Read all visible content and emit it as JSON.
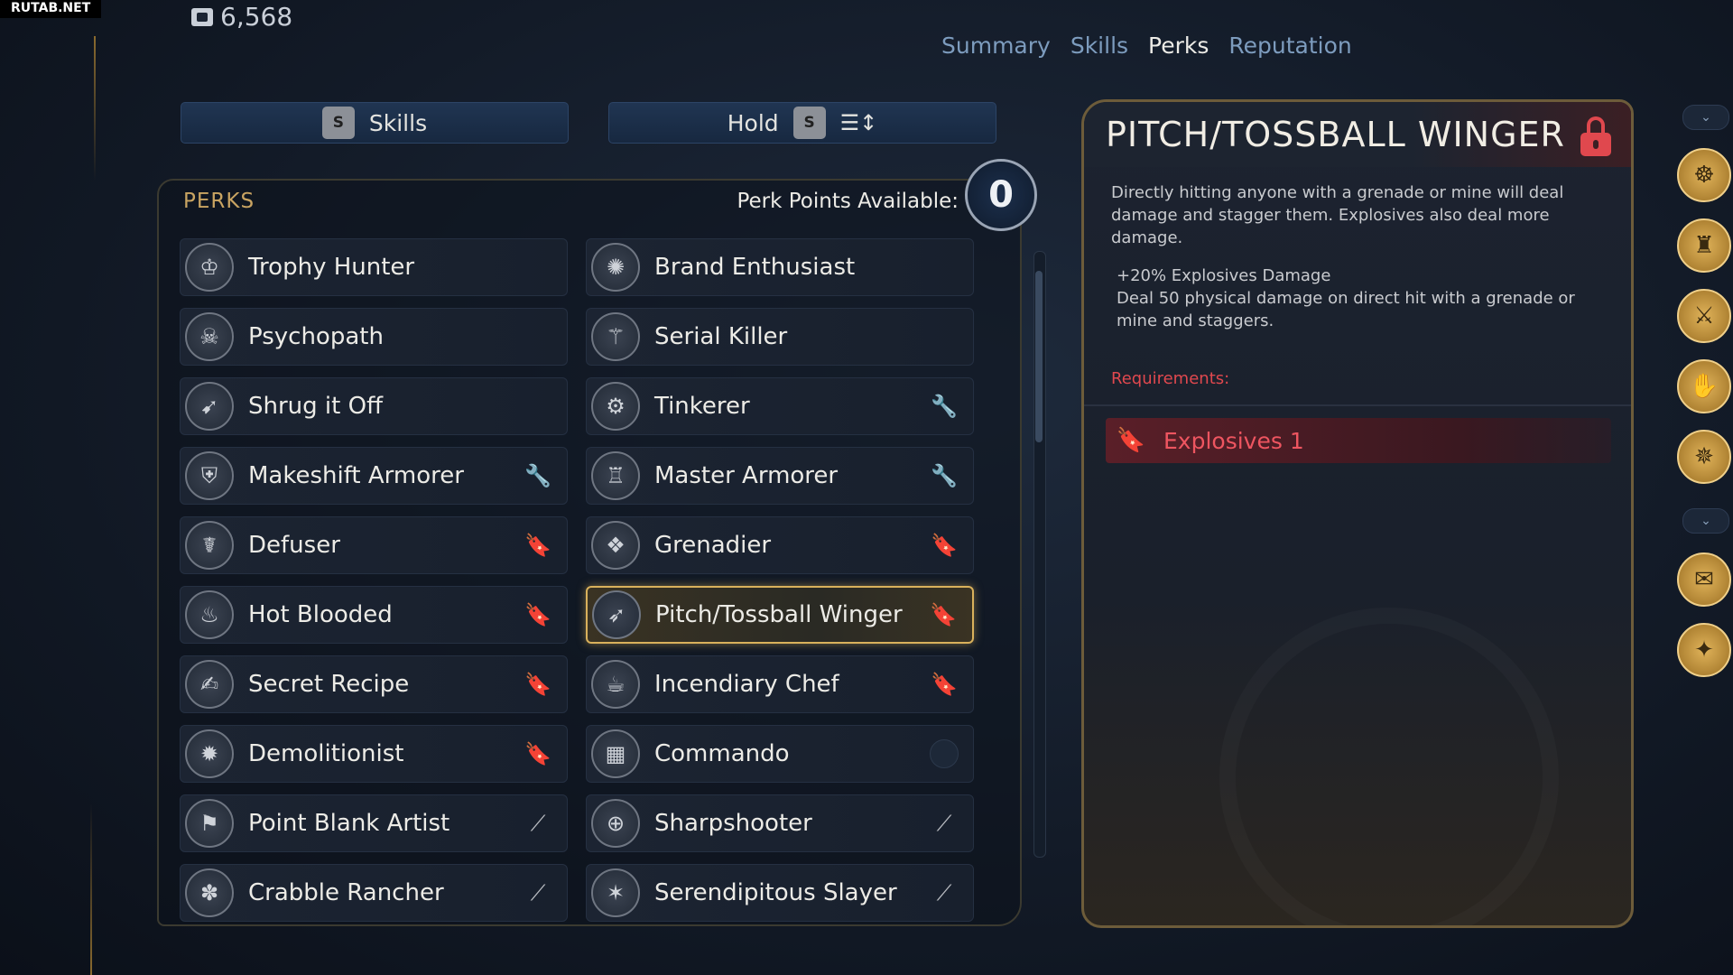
{
  "watermark": "RUTAB.NET",
  "currency": {
    "value": "6,568",
    "icon": "token-icon"
  },
  "tabs": [
    {
      "label": "Summary",
      "active": false
    },
    {
      "label": "Skills",
      "active": false
    },
    {
      "label": "Perks",
      "active": true
    },
    {
      "label": "Reputation",
      "active": false
    }
  ],
  "buttons": {
    "skills": {
      "key": "S",
      "label": "Skills"
    },
    "hold": {
      "label": "Hold",
      "key": "S",
      "icon": "sort-icon"
    }
  },
  "perks_panel": {
    "title": "PERKS",
    "points_label": "Perk Points Available:",
    "points_value": "0"
  },
  "perks": [
    {
      "name": "Trophy Hunter",
      "icon": "trophy-icon",
      "tag": ""
    },
    {
      "name": "Brand Enthusiast",
      "icon": "burst-icon",
      "tag": ""
    },
    {
      "name": "Psychopath",
      "icon": "skull-icon",
      "tag": ""
    },
    {
      "name": "Serial Killer",
      "icon": "blade-icon",
      "tag": ""
    },
    {
      "name": "Shrug it Off",
      "icon": "shrug-icon",
      "tag": ""
    },
    {
      "name": "Tinkerer",
      "icon": "gear-bot-icon",
      "tag": "wrench-icon"
    },
    {
      "name": "Makeshift Armorer",
      "icon": "armor-icon",
      "tag": "wrench-icon"
    },
    {
      "name": "Master Armorer",
      "icon": "armor-master-icon",
      "tag": "wrench-icon"
    },
    {
      "name": "Defuser",
      "icon": "defuser-icon",
      "tag": "grenade-icon"
    },
    {
      "name": "Grenadier",
      "icon": "grenades-icon",
      "tag": "grenade-icon"
    },
    {
      "name": "Hot Blooded",
      "icon": "flame-icon",
      "tag": "grenade-icon"
    },
    {
      "name": "Pitch/Tossball Winger",
      "icon": "throw-icon",
      "tag": "grenade-icon",
      "selected": true
    },
    {
      "name": "Secret Recipe",
      "icon": "recipe-icon",
      "tag": "grenade-icon"
    },
    {
      "name": "Incendiary Chef",
      "icon": "chef-icon",
      "tag": "grenade-icon"
    },
    {
      "name": "Demolitionist",
      "icon": "explosion-icon",
      "tag": "grenade-icon"
    },
    {
      "name": "Commando",
      "icon": "grid-icon",
      "tag": "empty-slot"
    },
    {
      "name": "Point Blank Artist",
      "icon": "pistol-icon",
      "tag": "gun-icon"
    },
    {
      "name": "Sharpshooter",
      "icon": "crosshair-icon",
      "tag": "gun-icon"
    },
    {
      "name": "Crabble Rancher",
      "icon": "crab-icon",
      "tag": "gun-icon"
    },
    {
      "name": "Serendipitous Slayer",
      "icon": "star-burst-icon",
      "tag": "gun-icon"
    }
  ],
  "detail": {
    "title": "PITCH/TOSSBALL WINGER",
    "locked": true,
    "description": "Directly hitting anyone with a grenade or mine will deal damage and stagger them. Explosives also deal more damage.",
    "bonus_1": "+20% Explosives Damage",
    "bonus_2": "Deal 50 physical damage on direct hit with a grenade or mine and staggers.",
    "requirements_label": "Requirements:",
    "requirement": {
      "label": "Explosives 1",
      "icon": "grenade-icon"
    }
  },
  "sidebar": [
    {
      "icon": "character-icon"
    },
    {
      "icon": "companion-icon"
    },
    {
      "icon": "melee-icon"
    },
    {
      "icon": "hand-icon"
    },
    {
      "icon": "stealth-icon"
    },
    {
      "icon": "map-icon"
    },
    {
      "icon": "creature-icon"
    }
  ],
  "colors": {
    "accent_gold": "#d9b15c",
    "locked_red": "#e0484e",
    "tab_inactive": "#7d9cbe"
  }
}
